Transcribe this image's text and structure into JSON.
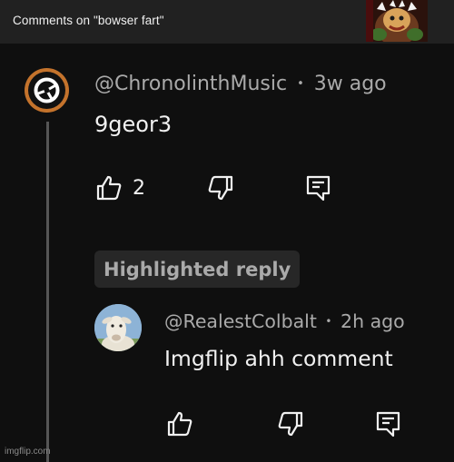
{
  "header": {
    "title": "Comments on \"bowser fart\""
  },
  "comment": {
    "author": "@ChronolinthMusic",
    "separator": "•",
    "time": "3w ago",
    "text": "9geor3",
    "like_count": "2"
  },
  "highlight_badge": "Highlighted reply",
  "reply": {
    "author": "@RealestColbalt",
    "separator": "•",
    "time": "2h ago",
    "text": "Imgflip ahh comment"
  },
  "watermark": "imgflip.com",
  "icons": {
    "like": "thumbs-up-icon",
    "dislike": "thumbs-down-icon",
    "reply": "reply-comment-icon"
  }
}
